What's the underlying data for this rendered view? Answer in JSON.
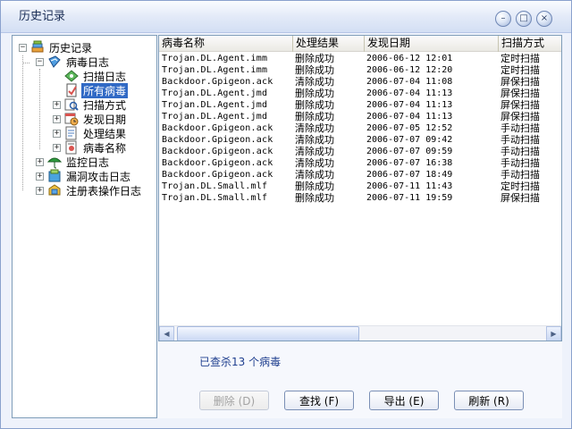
{
  "window": {
    "title": "历史记录",
    "minimize_glyph": "–",
    "maximize_glyph": "□",
    "close_glyph": "×"
  },
  "tree": {
    "root": {
      "label": "历史记录",
      "icon": "books-icon",
      "expander": "−"
    },
    "virus_log": {
      "label": "病毒日志",
      "icon": "virus-log-icon",
      "expander": "−"
    },
    "virus_children": [
      {
        "label": "扫描日志",
        "icon": "scan-log-icon",
        "expander": ""
      },
      {
        "label": "所有病毒",
        "icon": "all-virus-icon",
        "expander": "",
        "selected": true
      },
      {
        "label": "扫描方式",
        "icon": "scan-mode-icon",
        "expander": "+"
      },
      {
        "label": "发现日期",
        "icon": "date-icon",
        "expander": "+"
      },
      {
        "label": "处理结果",
        "icon": "result-icon",
        "expander": "+"
      },
      {
        "label": "病毒名称",
        "icon": "virus-name-icon",
        "expander": "+"
      }
    ],
    "others": [
      {
        "label": "监控日志",
        "icon": "monitor-log-icon",
        "expander": "+"
      },
      {
        "label": "漏洞攻击日志",
        "icon": "exploit-log-icon",
        "expander": "+"
      },
      {
        "label": "注册表操作日志",
        "icon": "registry-log-icon",
        "expander": "+"
      }
    ]
  },
  "list": {
    "columns": [
      "病毒名称",
      "处理结果",
      "发现日期",
      "扫描方式"
    ],
    "rows": [
      [
        "Trojan.DL.Agent.imm",
        "删除成功",
        "2006-06-12 12:01",
        "定时扫描"
      ],
      [
        "Trojan.DL.Agent.imm",
        "删除成功",
        "2006-06-12 12:20",
        "定时扫描"
      ],
      [
        "Backdoor.Gpigeon.ack",
        "清除成功",
        "2006-07-04 11:08",
        "屏保扫描"
      ],
      [
        "Trojan.DL.Agent.jmd",
        "删除成功",
        "2006-07-04 11:13",
        "屏保扫描"
      ],
      [
        "Trojan.DL.Agent.jmd",
        "删除成功",
        "2006-07-04 11:13",
        "屏保扫描"
      ],
      [
        "Trojan.DL.Agent.jmd",
        "删除成功",
        "2006-07-04 11:13",
        "屏保扫描"
      ],
      [
        "Backdoor.Gpigeon.ack",
        "清除成功",
        "2006-07-05 12:52",
        "手动扫描"
      ],
      [
        "Backdoor.Gpigeon.ack",
        "清除成功",
        "2006-07-07 09:42",
        "手动扫描"
      ],
      [
        "Backdoor.Gpigeon.ack",
        "清除成功",
        "2006-07-07 09:59",
        "手动扫描"
      ],
      [
        "Backdoor.Gpigeon.ack",
        "清除成功",
        "2006-07-07 16:38",
        "手动扫描"
      ],
      [
        "Backdoor.Gpigeon.ack",
        "清除成功",
        "2006-07-07 18:49",
        "手动扫描"
      ],
      [
        "Trojan.DL.Small.mlf",
        "删除成功",
        "2006-07-11 11:43",
        "定时扫描"
      ],
      [
        "Trojan.DL.Small.mlf",
        "删除成功",
        "2006-07-11 19:59",
        "屏保扫描"
      ]
    ],
    "scroll_left": "◀",
    "scroll_right": "▶"
  },
  "status": {
    "text": "已查杀13 个病毒"
  },
  "buttons": {
    "delete": "删除 (D)",
    "find": "查找 (F)",
    "export": "导出 (E)",
    "refresh": "刷新 (R)"
  },
  "colors": {
    "selection": "#316ac5",
    "status_text": "#1f3f8f"
  }
}
